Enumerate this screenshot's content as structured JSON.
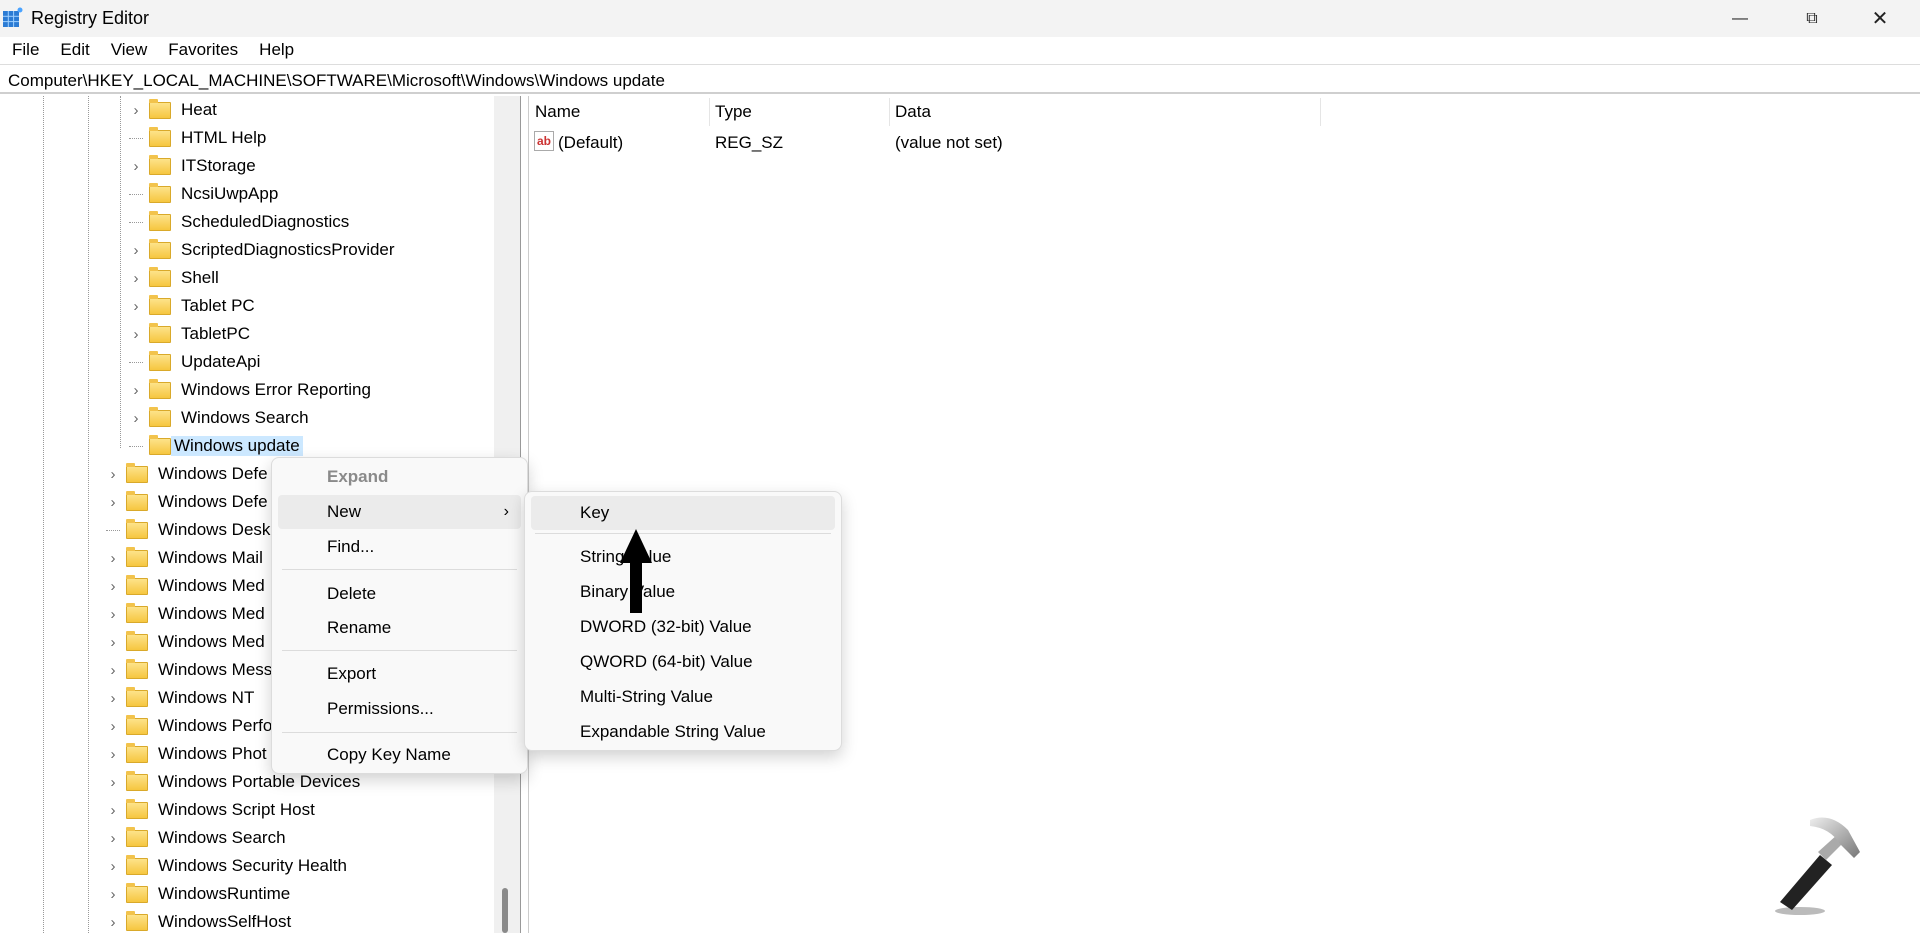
{
  "window": {
    "title": "Registry Editor",
    "controls": [
      "minimize",
      "maximize",
      "close"
    ]
  },
  "menubar": [
    "File",
    "Edit",
    "View",
    "Favorites",
    "Help"
  ],
  "address": "Computer\\HKEY_LOCAL_MACHINE\\SOFTWARE\\Microsoft\\Windows\\Windows update",
  "tree": {
    "inner": [
      {
        "label": "Heat",
        "expandable": true
      },
      {
        "label": "HTML Help",
        "expandable": false
      },
      {
        "label": "ITStorage",
        "expandable": true
      },
      {
        "label": "NcsiUwpApp",
        "expandable": false
      },
      {
        "label": "ScheduledDiagnostics",
        "expandable": false
      },
      {
        "label": "ScriptedDiagnosticsProvider",
        "expandable": true
      },
      {
        "label": "Shell",
        "expandable": true
      },
      {
        "label": "Tablet PC",
        "expandable": true
      },
      {
        "label": "TabletPC",
        "expandable": true
      },
      {
        "label": "UpdateApi",
        "expandable": false
      },
      {
        "label": "Windows Error Reporting",
        "expandable": true
      },
      {
        "label": "Windows Search",
        "expandable": true
      },
      {
        "label": "Windows update",
        "expandable": false,
        "selected": true
      }
    ],
    "outer": [
      {
        "label": "Windows Defe",
        "expandable": true
      },
      {
        "label": "Windows Defe",
        "expandable": true
      },
      {
        "label": "Windows Desk",
        "expandable": false
      },
      {
        "label": "Windows Mail",
        "expandable": true
      },
      {
        "label": "Windows Med",
        "expandable": true
      },
      {
        "label": "Windows Med",
        "expandable": true
      },
      {
        "label": "Windows Med",
        "expandable": true
      },
      {
        "label": "Windows Mess",
        "expandable": true
      },
      {
        "label": "Windows NT",
        "expandable": true
      },
      {
        "label": "Windows Perfo",
        "expandable": true
      },
      {
        "label": "Windows Phot",
        "expandable": true
      },
      {
        "label": "Windows Portable Devices",
        "expandable": true
      },
      {
        "label": "Windows Script Host",
        "expandable": true
      },
      {
        "label": "Windows Search",
        "expandable": true
      },
      {
        "label": "Windows Security Health",
        "expandable": true
      },
      {
        "label": "WindowsRuntime",
        "expandable": true
      },
      {
        "label": "WindowsSelfHost",
        "expandable": true
      }
    ]
  },
  "values": {
    "columns": [
      "Name",
      "Type",
      "Data"
    ],
    "rows": [
      {
        "name": "(Default)",
        "type": "REG_SZ",
        "data": "(value not set)",
        "icon": "string-value-icon"
      }
    ]
  },
  "context_menu": {
    "expand": "Expand",
    "new": "New",
    "find": "Find...",
    "delete": "Delete",
    "rename": "Rename",
    "export": "Export",
    "permissions": "Permissions...",
    "copy_key_name": "Copy Key Name"
  },
  "submenu": {
    "key": "Key",
    "string": "String Value",
    "binary": "Binary Value",
    "dword": "DWORD (32-bit) Value",
    "qword": "QWORD (64-bit) Value",
    "multi": "Multi-String Value",
    "expandable": "Expandable String Value"
  }
}
